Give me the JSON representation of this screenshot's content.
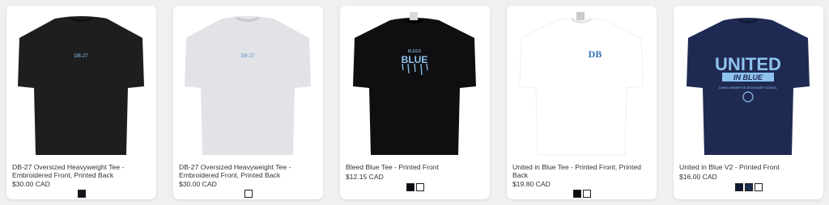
{
  "products": [
    {
      "title": "DB-27 Oversized Heavyweight Tee - Embroidered Front, Printed Back",
      "price": "$30.00 CAD",
      "print_text": "DB-27",
      "swatches": [
        "#15171e"
      ]
    },
    {
      "title": "DB-27 Oversized Heavyweight Tee - Embroidered Front, Printed Back",
      "price": "$30.00 CAD",
      "print_text": "DB-27",
      "swatches": [
        "#ffffff"
      ]
    },
    {
      "title": "Bleed Blue Tee - Printed Front",
      "price": "$12.15 CAD",
      "print_small": "BLEED",
      "print_big": "BLUE",
      "swatches": [
        "#0c0c12",
        "#ffffff"
      ]
    },
    {
      "title": "United in Blue Tee - Printed Front, Printed Back",
      "price": "$19.80 CAD",
      "print_text": "DB",
      "swatches": [
        "#0c0c12",
        "#ffffff"
      ]
    },
    {
      "title": "United in Blue V2 - Printed Front",
      "price": "$16.00 CAD",
      "print_big": "UNITED",
      "print_mid": "IN BLUE",
      "print_small": "DANIEL BRAMPTON SECONDARY SCHOOL",
      "swatches": [
        "#0e1830",
        "#1d2c4f",
        "#ffffff"
      ]
    }
  ],
  "colors": {
    "shirt_black": "#1e1e20",
    "shirt_grey": "#e2e3e6",
    "shirt_navy": "#1f2a52",
    "print_blue": "#8fc3ee"
  }
}
